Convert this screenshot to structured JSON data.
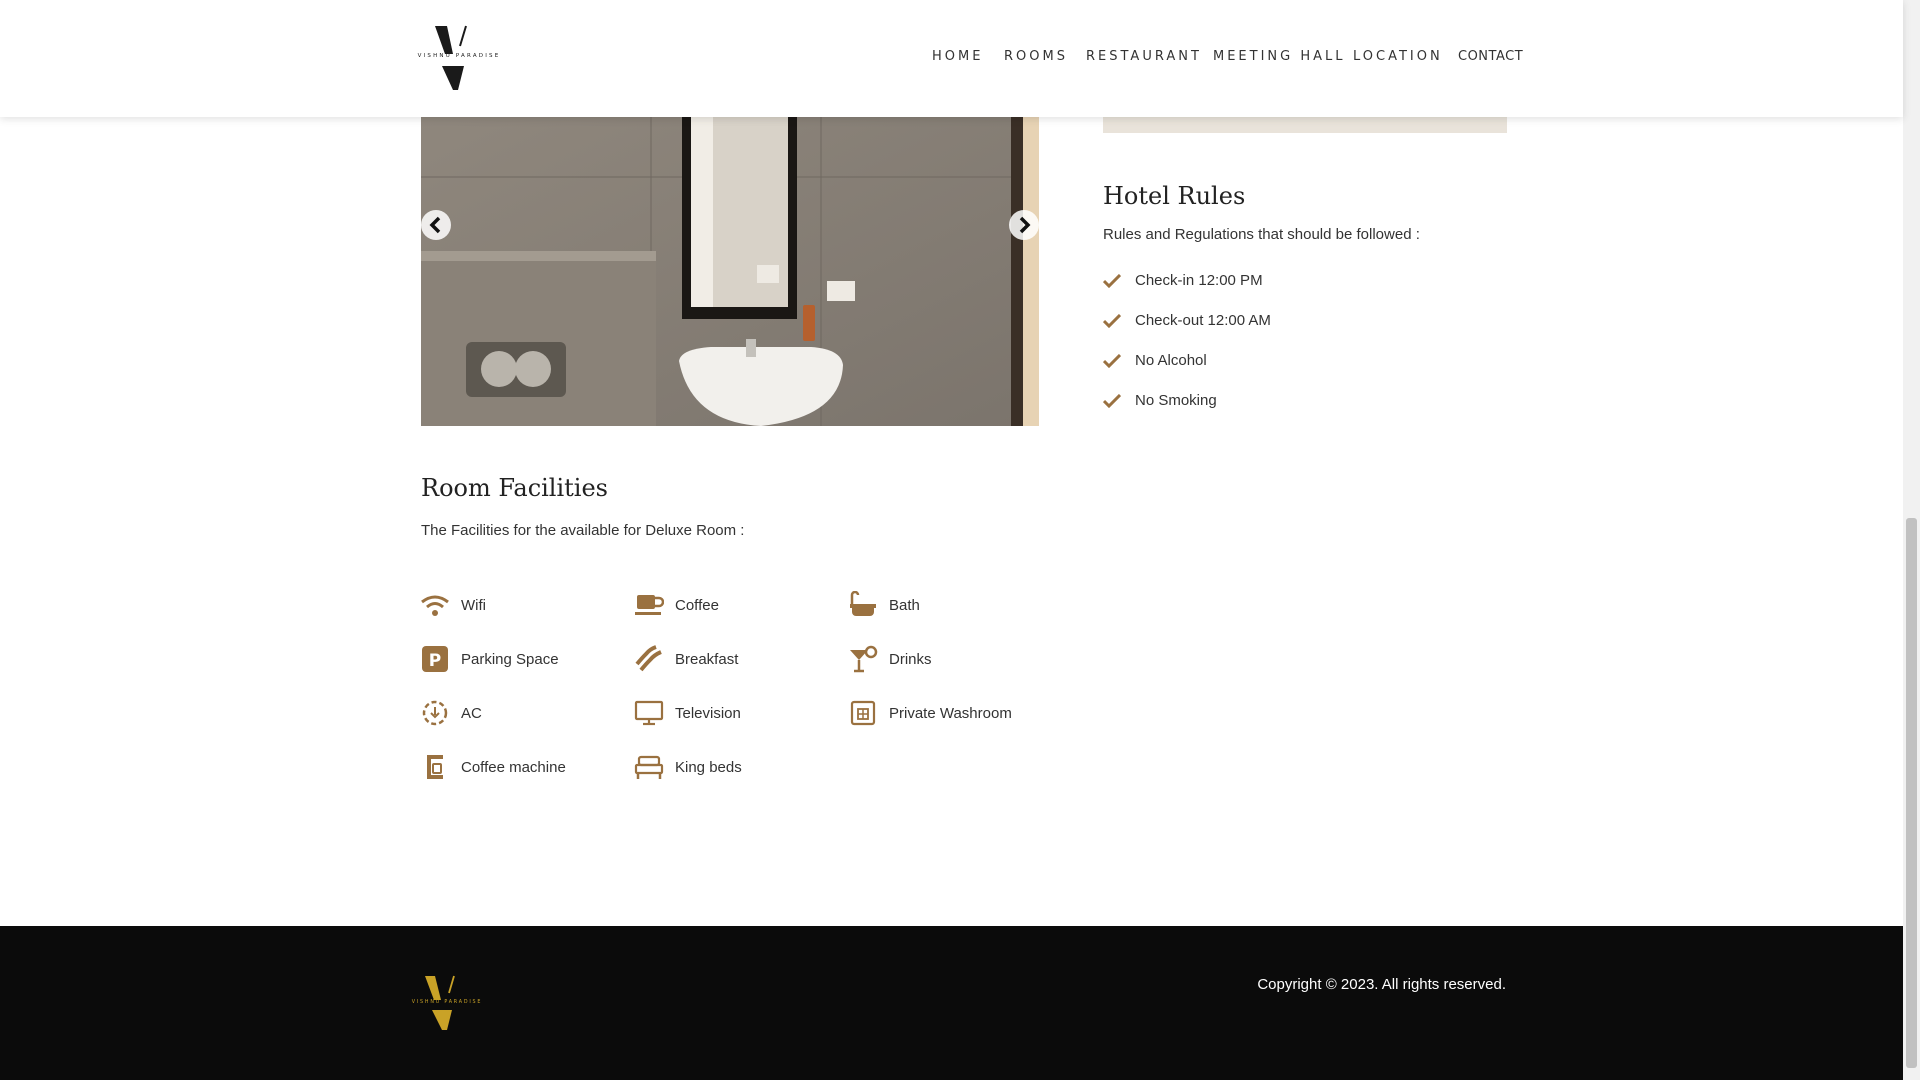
{
  "brand": {
    "name": "VISHNU PARADISE"
  },
  "nav": {
    "items": [
      "HOME",
      "ROOMS",
      "RESTAURANT",
      "MEETING HALL",
      "LOCATION",
      "CONTACT"
    ]
  },
  "hotel_rules": {
    "title": "Hotel Rules",
    "subtitle": "Rules and Regulations that should be followed :",
    "items": [
      "Check-in 12:00 PM",
      "Check-out 12:00 AM",
      "No Alcohol",
      "No Smoking"
    ]
  },
  "facilities": {
    "title": "Room Facilities",
    "subtitle": "The Facilities for the available for Deluxe Room :",
    "items": [
      {
        "label": "Wifi",
        "icon": "wifi-icon"
      },
      {
        "label": "Coffee",
        "icon": "coffee-cup-icon"
      },
      {
        "label": "Bath",
        "icon": "bath-icon"
      },
      {
        "label": "Parking Space",
        "icon": "parking-icon"
      },
      {
        "label": "Breakfast",
        "icon": "bacon-icon"
      },
      {
        "label": "Drinks",
        "icon": "cocktail-icon"
      },
      {
        "label": "AC",
        "icon": "ac-icon"
      },
      {
        "label": "Television",
        "icon": "tv-icon"
      },
      {
        "label": "Private Washroom",
        "icon": "washroom-icon"
      },
      {
        "label": "Coffee machine",
        "icon": "coffee-machine-icon"
      },
      {
        "label": "King beds",
        "icon": "bed-icon"
      }
    ]
  },
  "slider": {
    "image": "bathroom-photo",
    "prev_icon": "chevron-left-icon",
    "next_icon": "chevron-right-icon"
  },
  "footer": {
    "copyright": "Copyright © 2023. All rights reserved."
  },
  "colors": {
    "accent": "#9a7140",
    "gold": "#c9a227",
    "footer_bg": "#0b0b0b",
    "beige": "#e9e3da"
  }
}
